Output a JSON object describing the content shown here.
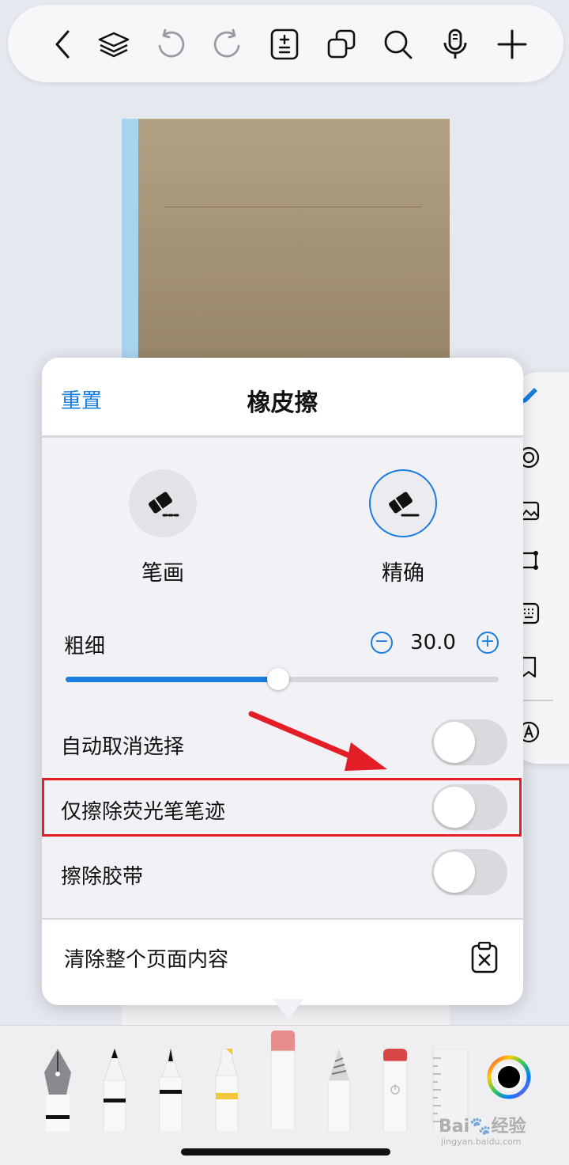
{
  "toolbar": {
    "icons": [
      "back-icon",
      "layers-icon",
      "undo-icon",
      "redo-icon",
      "page-adjust-icon",
      "duplicate-icon",
      "search-icon",
      "microphone-icon",
      "add-icon"
    ]
  },
  "eraser_panel": {
    "reset_label": "重置",
    "title": "橡皮擦",
    "modes": [
      {
        "label": "笔画",
        "icon": "stroke-eraser-icon",
        "selected": false
      },
      {
        "label": "精确",
        "icon": "precise-eraser-icon",
        "selected": true
      }
    ],
    "thickness": {
      "label": "粗细",
      "value": "30.0",
      "level": 0.49
    },
    "toggles": [
      {
        "label": "自动取消选择",
        "on": false
      },
      {
        "label": "仅擦除荧光笔笔迹",
        "on": false
      },
      {
        "label": "擦除胶带",
        "on": false
      }
    ],
    "clear_page_label": "清除整个页面内容"
  },
  "side_rail": {
    "icons": [
      "pen-icon",
      "lasso-icon",
      "image-icon",
      "shape-icon",
      "keyboard-icon",
      "bookmark-icon",
      "text-icon"
    ]
  },
  "tools": [
    "fountain-pen-icon",
    "ballpoint-pen-icon",
    "brush-pen-icon",
    "highlighter-icon",
    "eraser-tool-icon",
    "pencil-icon",
    "tape-icon",
    "ruler-icon",
    "color-picker-icon"
  ],
  "colors": {
    "accent": "#1a7de0",
    "annotation": "#e31e26",
    "current_color": "#000000"
  },
  "watermark": {
    "text": "Bai🐾经验",
    "sub": "jingyan.baidu.com"
  }
}
